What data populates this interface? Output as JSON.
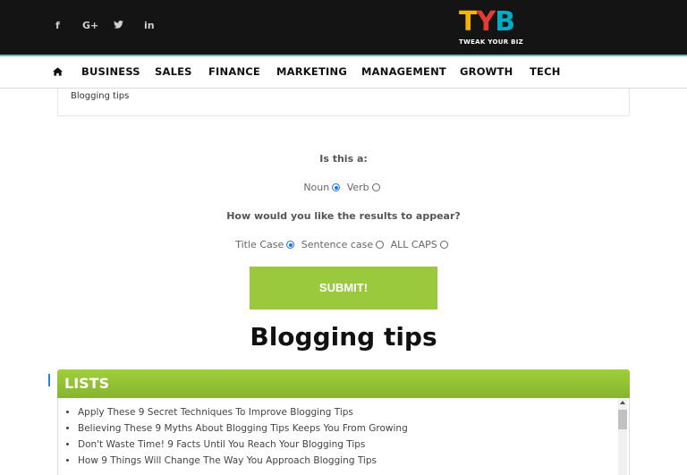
{
  "header": {
    "social": [
      {
        "icon": "facebook-icon",
        "glyph": "f"
      },
      {
        "icon": "google-plus-icon",
        "glyph": "G+"
      },
      {
        "icon": "twitter-icon",
        "glyph": "🐦"
      },
      {
        "icon": "linkedin-icon",
        "glyph": "in"
      }
    ],
    "logo": {
      "letters": [
        "T",
        "Y",
        "B"
      ],
      "colors": [
        "#f4b400",
        "#e53935",
        "#00acc1"
      ],
      "tagline": "TWEAK YOUR BIZ"
    },
    "accent_line_color": "#5bc0c8"
  },
  "nav": {
    "home_icon": "home-icon",
    "items": [
      "BUSINESS",
      "SALES",
      "FINANCE",
      "MARKETING",
      "MANAGEMENT",
      "GROWTH",
      "TECH"
    ]
  },
  "form": {
    "input_value": "Blogging tips",
    "question1": "Is this a:",
    "options1": [
      {
        "label": "Noun",
        "selected": true
      },
      {
        "label": "Verb",
        "selected": false
      }
    ],
    "question2": "How would you like the results to appear?",
    "options2": [
      {
        "label": "Title Case",
        "selected": true
      },
      {
        "label": "Sentence case",
        "selected": false
      },
      {
        "label": "ALL CAPS",
        "selected": false
      }
    ],
    "submit_label": "SUBMIT!",
    "submit_color": "#9bc93e"
  },
  "results": {
    "title": "Blogging tips",
    "section_label": "LISTS",
    "section_color": "#9bc93e",
    "items": [
      "Apply These 9 Secret Techniques To Improve Blogging Tips",
      "Believing These 9 Myths About Blogging Tips Keeps You From Growing",
      "Don't Waste Time! 9 Facts Until You Reach Your Blogging Tips",
      "How 9 Things Will Change The Way You Approach Blogging Tips"
    ]
  }
}
